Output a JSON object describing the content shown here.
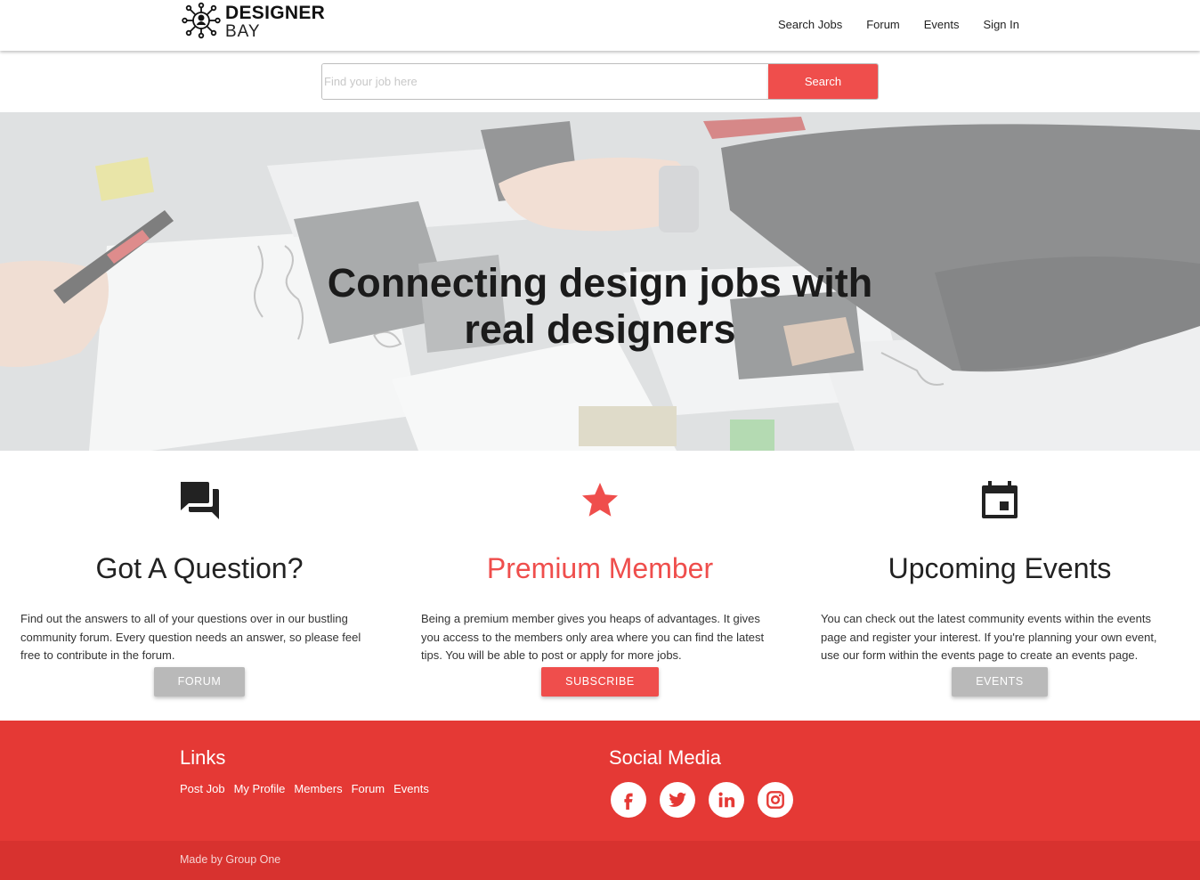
{
  "brand": {
    "line1": "DESIGNER",
    "line2": "BAY"
  },
  "nav": {
    "items": [
      {
        "label": "Search Jobs"
      },
      {
        "label": "Forum"
      },
      {
        "label": "Events"
      },
      {
        "label": "Sign In"
      }
    ]
  },
  "search": {
    "placeholder": "Find your job here",
    "button_label": "Search"
  },
  "hero": {
    "title_line1": "Connecting design jobs with",
    "title_line2": "real designers"
  },
  "features": [
    {
      "icon": "forum-icon",
      "title": "Got A Question?",
      "text": "Find out the answers to all of your questions over in our bustling community forum. Every question needs an answer, so please feel free to contribute in the forum.",
      "button": "FORUM"
    },
    {
      "icon": "star-icon",
      "title": "Premium Member",
      "text": "Being a premium member gives you heaps of advantages. It gives you access to the members only area where you can find the latest tips. You will be able to post or apply for more jobs.",
      "button": "SUBSCRIBE"
    },
    {
      "icon": "calendar-icon",
      "title": "Upcoming Events",
      "text": "You can check out the latest community events within the events page and register your interest. If you're planning your own event, use our form within the events page to create an events page.",
      "button": "EVENTS"
    }
  ],
  "footer": {
    "links_heading": "Links",
    "links": [
      "Post Job",
      "My Profile",
      "Members",
      "Forum",
      "Events"
    ],
    "social_heading": "Social Media",
    "social": [
      "facebook-icon",
      "twitter-icon",
      "linkedin-icon",
      "instagram-icon"
    ],
    "credit": "Made by Group One"
  },
  "colors": {
    "accent": "#ef4e4c",
    "footer": "#e53935",
    "footer_bottom": "#d8322f",
    "button_grey": "#b9b9b9"
  }
}
